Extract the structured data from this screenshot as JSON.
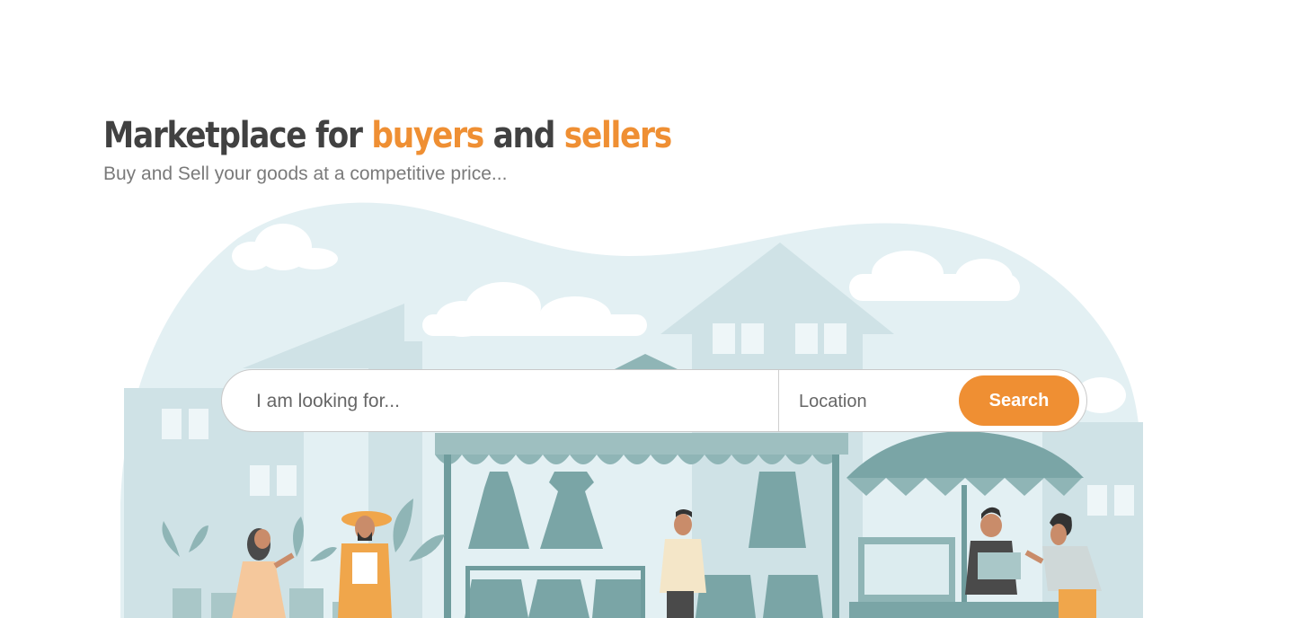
{
  "hero": {
    "title_part1": "Marketplace for ",
    "title_accent1": "buyers",
    "title_part2": " and ",
    "title_accent2": "sellers",
    "subtitle": "Buy and Sell your goods at a competitive price..."
  },
  "search": {
    "keyword_placeholder": "I am looking for...",
    "location_placeholder": "Location",
    "button_label": "Search"
  },
  "colors": {
    "accent": "#ef8f33",
    "title_text": "#414141",
    "subtitle_text": "#7a7a7a",
    "background_blob": "#e3f0f3",
    "illustration_teal": "#7aa5a6"
  },
  "illustration": {
    "name": "marketplace-scene"
  }
}
